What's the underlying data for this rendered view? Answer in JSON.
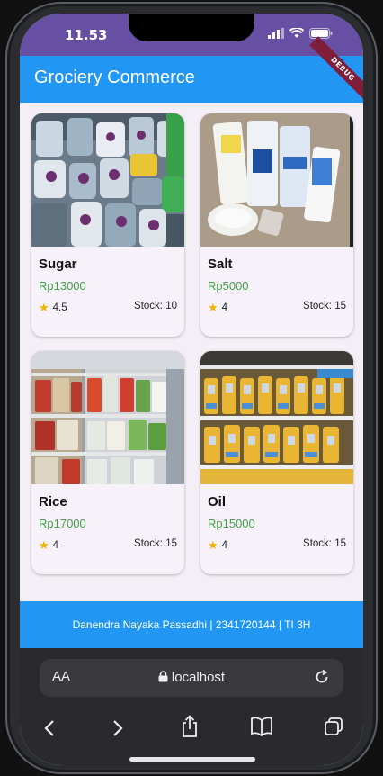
{
  "status": {
    "time": "11.53"
  },
  "appbar": {
    "title": "Grociery Commerce",
    "debug_label": "DEBUG"
  },
  "products": [
    {
      "name": "Sugar",
      "price": "Rp13000",
      "rating": "4.5",
      "stock": "Stock: 10"
    },
    {
      "name": "Salt",
      "price": "Rp5000",
      "rating": "4",
      "stock": "Stock: 15"
    },
    {
      "name": "Rice",
      "price": "Rp17000",
      "rating": "4",
      "stock": "Stock: 15"
    },
    {
      "name": "Oil",
      "price": "Rp15000",
      "rating": "4",
      "stock": "Stock: 15"
    }
  ],
  "footer": {
    "text": "Danendra Nayaka Passadhi | 2341720144 | TI 3H"
  },
  "browser": {
    "aa_label": "AA",
    "url": "localhost"
  },
  "colors": {
    "appbar": "#2196f3",
    "statusbar": "#6750a4",
    "price": "#43a047",
    "star": "#f5b400"
  },
  "icons": [
    "star-icon",
    "lock-icon",
    "reload-icon",
    "back-icon",
    "forward-icon",
    "share-icon",
    "bookmarks-icon",
    "tabs-icon"
  ]
}
